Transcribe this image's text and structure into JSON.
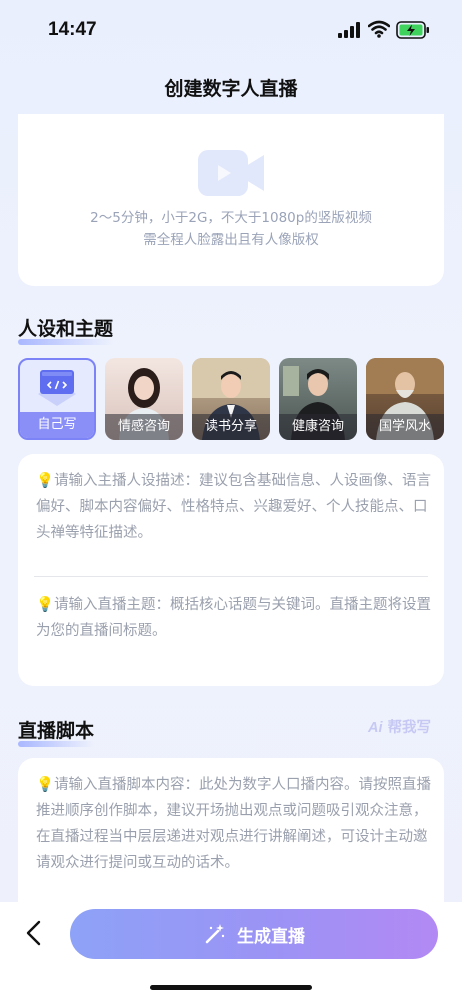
{
  "status": {
    "time": "14:47"
  },
  "header": {
    "title": "创建数字人直播"
  },
  "upload": {
    "line1": "2～5分钟，小于2G，不大于1080p的竖版视频",
    "line2": "需全程人脸露出且有人像版权"
  },
  "persona_section": {
    "title": "人设和主题",
    "items": [
      {
        "label": "自己写",
        "icon": "code-icon",
        "selected": true
      },
      {
        "label": "情感咨询"
      },
      {
        "label": "读书分享"
      },
      {
        "label": "健康咨询"
      },
      {
        "label": "国学风水"
      }
    ],
    "persona_placeholder": "请输入主播人设描述：建议包含基础信息、人设画像、语言偏好、脚本内容偏好、性格特点、兴趣爱好、个人技能点、口头禅等特征描述。",
    "theme_placeholder": "请输入直播主题：概括核心话题与关键词。直播主题将设置为您的直播间标题。"
  },
  "script_section": {
    "title": "直播脚本",
    "ai_help": "帮我写",
    "ai_prefix": "Ai",
    "placeholder": "请输入直播脚本内容：此处为数字人口播内容。请按照直播推进顺序创作脚本，建议开场抛出观点或问题吸引观众注意，在直播过程当中层层递进对观点进行讲解阐述，可设计主动邀请观众进行提问或互动的话术。"
  },
  "bottom": {
    "generate_label": "生成直播"
  },
  "colors": {
    "accent": "#8a8ff7",
    "hint_text": "#9aa0ad",
    "bulb": "#f2c94c"
  }
}
